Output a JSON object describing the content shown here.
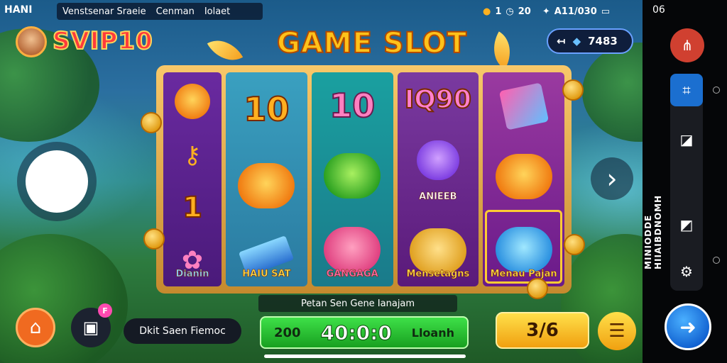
{
  "status_bar": {
    "left_label": "HANI",
    "segments": [
      "Venstsenar Sraeie",
      "Cenman",
      "Iolaet"
    ]
  },
  "header": {
    "vip_label": "SVIP10",
    "title": "GAME SLOT",
    "coins": "1",
    "timer": "20",
    "network": "A11/030",
    "balance": "7483"
  },
  "reels": {
    "col1": {
      "label": "Dianin"
    },
    "col2": {
      "number": "10",
      "label": "HAIU SAT"
    },
    "col3": {
      "number": "10",
      "label": "GANGAGA"
    },
    "col4": {
      "number": "IQ90",
      "label": "ANIEEB",
      "label2": "Mensetagns"
    },
    "col5": {
      "label": "Menau Pajan"
    },
    "col1_number": "1"
  },
  "info_bar": "Petan Sen Gene Ianajam",
  "bottom": {
    "mode_label": "Dkit Saen Fiemoc",
    "bet_left": "200",
    "bet_main": "40:0:0",
    "bet_right": "Lloanh",
    "spin_label": "3/6",
    "badge": "F"
  },
  "panel": {
    "time": "06",
    "side_text": "MINIODDE HIIAIBDNOMH"
  },
  "colors": {
    "title": "#ffc21a",
    "vip": "#ff3b3b",
    "bet_bar": "#3ee048",
    "spin": "#ffe04a",
    "fab": "#1060d0"
  }
}
